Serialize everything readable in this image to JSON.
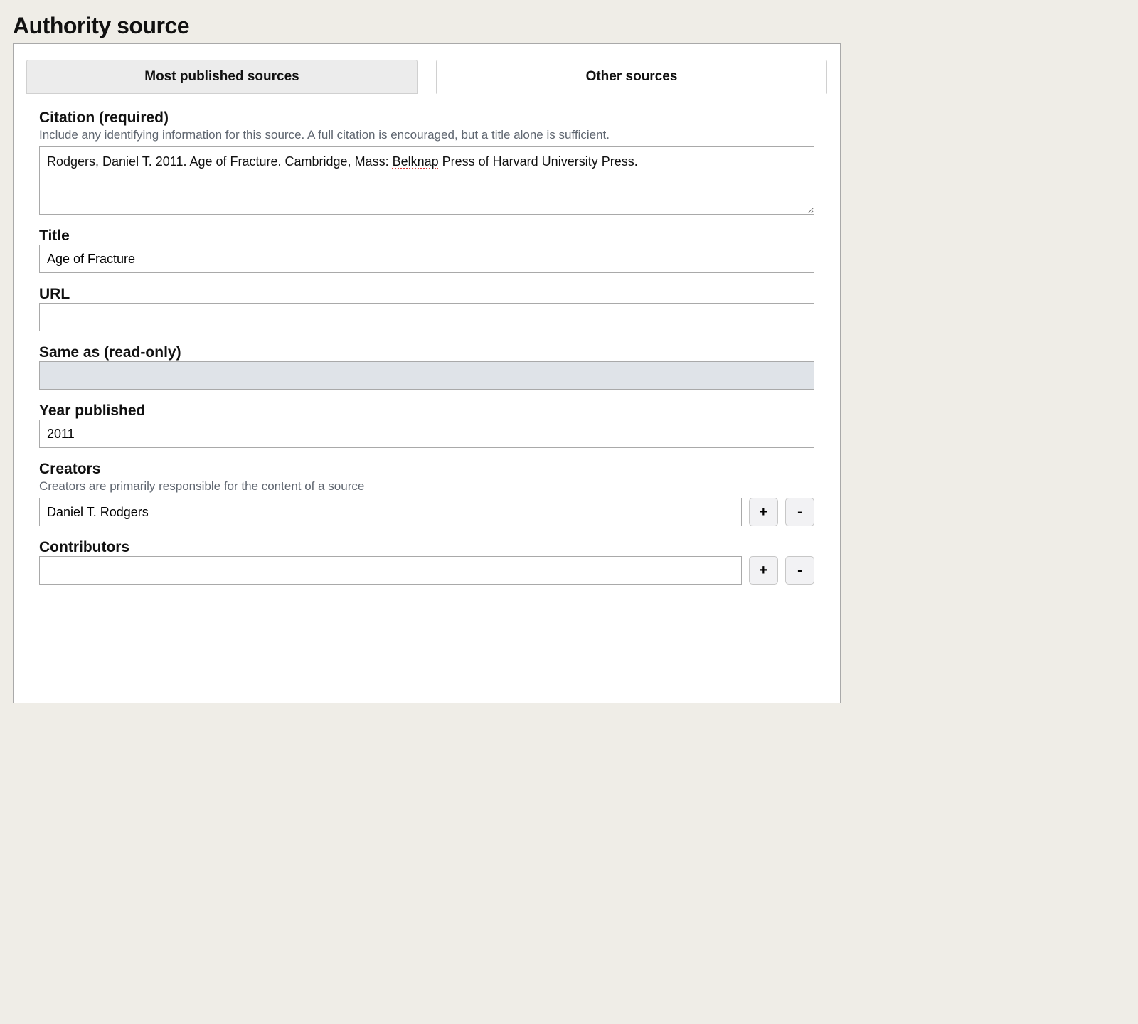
{
  "page": {
    "title": "Authority source"
  },
  "tabs": {
    "inactive_label": "Most published sources",
    "active_label": "Other sources"
  },
  "citation": {
    "label": "Citation (required)",
    "help": "Include any identifying information for this source. A full citation is encouraged, but a title alone is sufficient.",
    "value_prefix": "Rodgers, Daniel T. 2011. Age of Fracture. Cambridge, Mass: ",
    "value_marked": "Belknap",
    "value_suffix": " Press of Harvard University Press."
  },
  "title_field": {
    "label": "Title",
    "value": "Age of Fracture"
  },
  "url_field": {
    "label": "URL",
    "value": ""
  },
  "same_as": {
    "label": "Same as (read-only)"
  },
  "year": {
    "label": "Year published",
    "value": "2011"
  },
  "creators": {
    "label": "Creators",
    "help": "Creators are primarily responsible for the content of a source",
    "value": "Daniel T. Rodgers",
    "add": "+",
    "remove": "-"
  },
  "contributors": {
    "label": "Contributors",
    "value": "",
    "add": "+",
    "remove": "-"
  }
}
